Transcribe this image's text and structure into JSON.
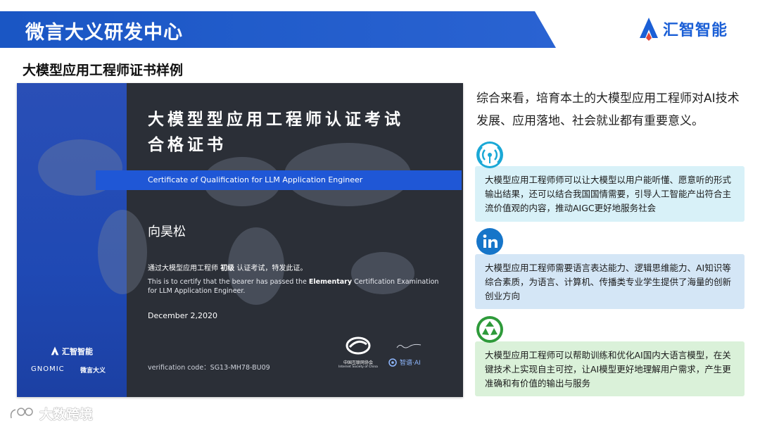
{
  "header": {
    "title": "微言大义研发中心",
    "logo_text": "汇智智能",
    "band_color": "#1f57c9"
  },
  "subtitle": "大模型应用工程师证书样例",
  "certificate": {
    "title_line1": "大模型型应用工程师认证考试",
    "title_line2": "合格证书",
    "title_en": "Certificate of Qualification for LLM Application Engineer",
    "holder_name": "向昊松",
    "statement_cn_pre": "通过大模型应用工程师",
    "statement_cn_level": "初级",
    "statement_cn_post": "认证考试，特发此证。",
    "statement_en_pre": "This is to certify that the bearer has passed the",
    "statement_en_level": "Elementary",
    "statement_en_post": "Certification Examination for LLM Application Engineer.",
    "date": "December 2,2020",
    "verification": "verification code：SG13-MH78-BU09",
    "side_logo_text": "汇智智能",
    "side_brand1": "GNOMIC",
    "side_brand2": "微言大义",
    "seal_org_cn": "中国互联网协会",
    "seal_org_en": "Internet Society of China",
    "seal_partner": "智谱·AI"
  },
  "summary": "综合来看，培育本土的大模型应用工程师对AI技术发展、应用落地、社会就业都有重要意义。",
  "cards": [
    {
      "icon": "wifi-signal-icon",
      "text": "大模型应用工程师师可以让大模型以用户能听懂、愿意听的形式输出结果，还可以结合我国国情需要，引导人工智能产出符合主流价值观的内容，推动AIGC更好地服务社会"
    },
    {
      "icon": "linkedin-icon",
      "text": "大模型应用工程师需要语言表达能力、逻辑思维能力、AI知识等综合素质，为语言、计算机、传播类专业学生提供了海量的创新创业方向"
    },
    {
      "icon": "recycle-icon",
      "text": "大模型应用工程师可以帮助训练和优化AI国内大语言模型，在关键技术上实现自主可控，让AI模型更好地理解用户需求，产生更准确和有价值的输出与服务"
    }
  ],
  "watermark": "大数跨境"
}
